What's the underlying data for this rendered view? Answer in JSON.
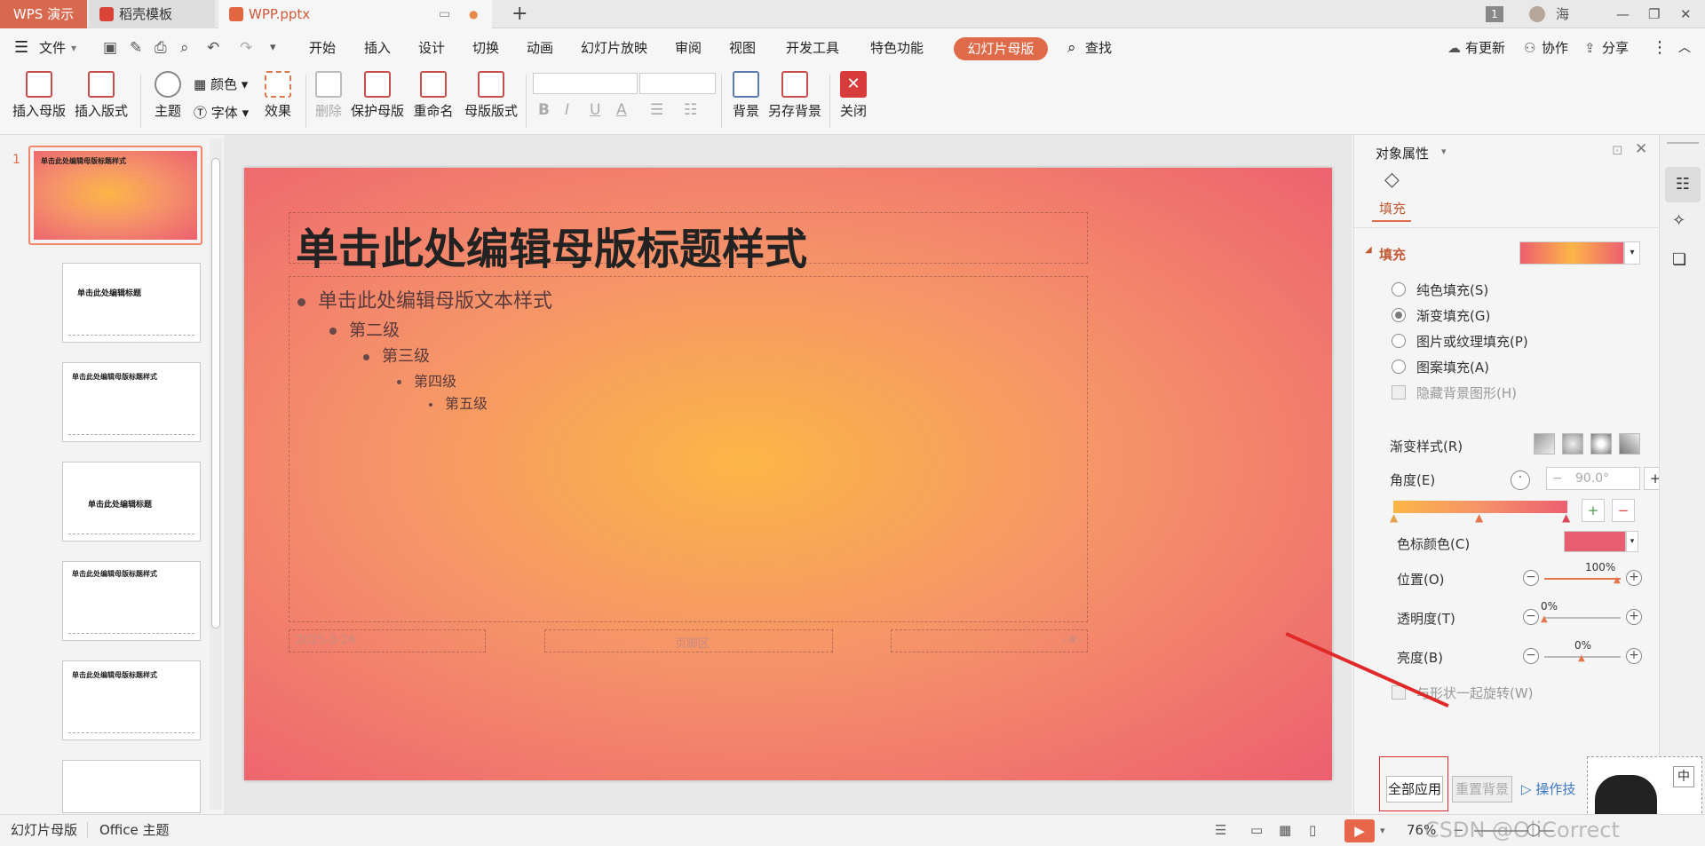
{
  "titlebar": {
    "app_tab": "WPS 演示",
    "doc_tabs": [
      {
        "label": "稻壳模板"
      },
      {
        "label": "WPP.pptx"
      }
    ],
    "badge": "1",
    "user": "海"
  },
  "menubar": {
    "file": "文件",
    "items": [
      "开始",
      "插入",
      "设计",
      "切换",
      "动画",
      "幻灯片放映",
      "审阅",
      "视图",
      "开发工具",
      "特色功能"
    ],
    "active_pill": "幻灯片母版",
    "search": "查找",
    "right": [
      "有更新",
      "协作",
      "分享"
    ]
  },
  "ribbon": {
    "insert_master": "插入母版",
    "insert_layout": "插入版式",
    "theme": "主题",
    "color": "颜色",
    "font": "字体",
    "effect": "效果",
    "delete": "删除",
    "protect_master": "保护母版",
    "rename": "重命名",
    "master_layout": "母版版式",
    "background": "背景",
    "save_background": "另存背景",
    "close": "关闭",
    "format_bold": "B",
    "format_italic": "I",
    "format_underline": "U",
    "format_fontcolor": "A"
  },
  "thumbnails": {
    "first_index": "1",
    "first_title": "单击此处编辑母版标题样式",
    "thumb2_title": "单击此处编辑标题",
    "thumb3_title": "单击此处编辑母版标题样式",
    "thumb4_title": "单击此处编辑标题",
    "thumb5_title": "单击此处编辑母版标题样式",
    "thumb6_title": "单击此处编辑母版标题样式"
  },
  "slide": {
    "title": "单击此处编辑母版标题样式",
    "levels": [
      "单击此处编辑母版文本样式",
      "第二级",
      "第三级",
      "第四级",
      "第五级"
    ],
    "footer_date": "2025-3-24",
    "footer_center": "页脚区",
    "footer_num": "‹#›"
  },
  "props": {
    "header": "对象属性",
    "tab": "填充",
    "section": "填充",
    "options": [
      "纯色填充(S)",
      "渐变填充(G)",
      "图片或纹理填充(P)",
      "图案填充(A)"
    ],
    "hide_bg": "隐藏背景图形(H)",
    "gradient_style": "渐变样式(R)",
    "angle_label": "角度(E)",
    "angle_value": "90.0°",
    "stop_color_label": "色标颜色(C)",
    "position_label": "位置(O)",
    "position_value": "100%",
    "transparency_label": "透明度(T)",
    "transparency_value": "0%",
    "brightness_label": "亮度(B)",
    "brightness_value": "0%",
    "rotate_with_shape": "与形状一起旋转(W)",
    "apply_all": "全部应用",
    "reset_bg": "重置背景",
    "tips": "操作技"
  },
  "statusbar": {
    "mode": "幻灯片母版",
    "theme": "Office 主题",
    "zoom": "76%",
    "watermark": "CSDN @OliCorrect",
    "ime": "中"
  },
  "colors": {
    "accent": "#e06b4a",
    "gradient_center": "#fcb647",
    "gradient_edge": "#ec5f6f"
  }
}
